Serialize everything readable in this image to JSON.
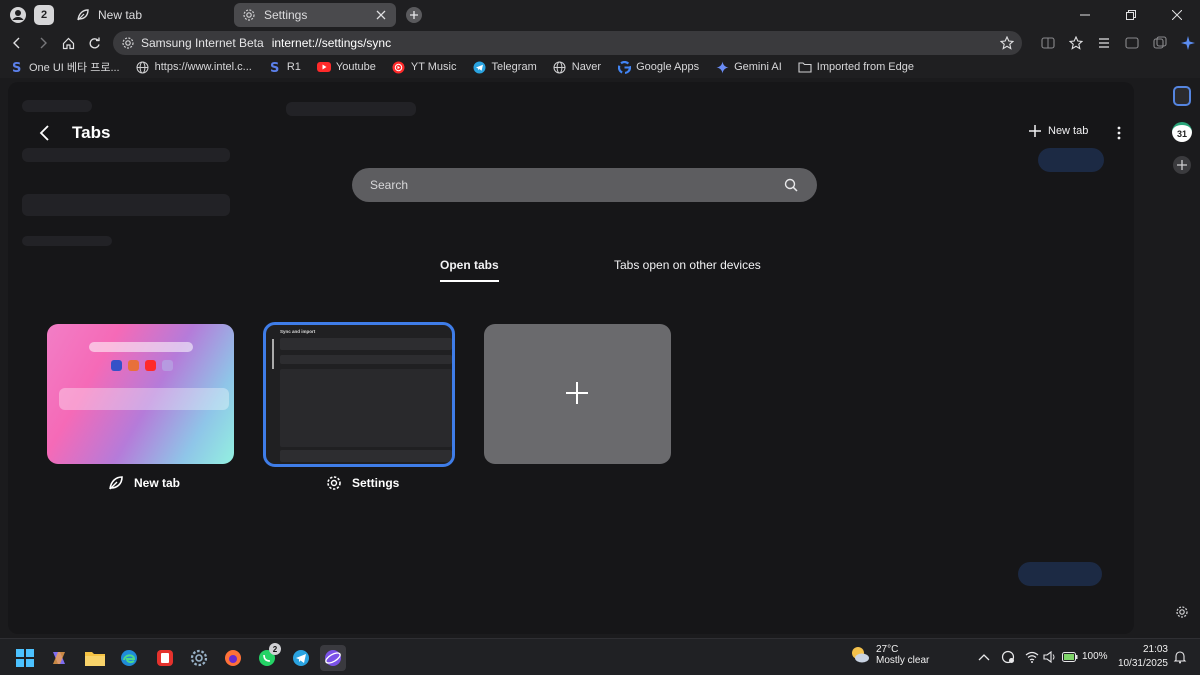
{
  "titlebar": {
    "tab_count": "2",
    "tabs": [
      {
        "title": "New tab",
        "icon": "leaf-icon",
        "active": false
      },
      {
        "title": "Settings",
        "icon": "gear-icon",
        "active": true
      }
    ]
  },
  "navbar": {
    "site_name": "Samsung Internet Beta",
    "url": "internet://settings/sync"
  },
  "bookmarks": [
    {
      "label": "One UI 베타 프로...",
      "icon": "samsung-s-icon"
    },
    {
      "label": "https://www.intel.c...",
      "icon": "globe-icon"
    },
    {
      "label": "R1",
      "icon": "samsung-s-icon"
    },
    {
      "label": "Youtube",
      "icon": "youtube-icon"
    },
    {
      "label": "YT Music",
      "icon": "yt-music-icon"
    },
    {
      "label": "Telegram",
      "icon": "telegram-icon"
    },
    {
      "label": "Naver",
      "icon": "globe-icon"
    },
    {
      "label": "Google Apps",
      "icon": "google-icon"
    },
    {
      "label": "Gemini AI",
      "icon": "gemini-icon"
    },
    {
      "label": "Imported from Edge",
      "icon": "folder-icon"
    }
  ],
  "tabs_panel": {
    "title": "Tabs",
    "new_tab_label": "New tab",
    "search_placeholder": "Search",
    "segments": {
      "open": "Open tabs",
      "other": "Tabs open on other devices"
    },
    "cards": [
      {
        "label": "New tab",
        "icon": "leaf-icon"
      },
      {
        "label": "Settings",
        "icon": "gear-icon"
      }
    ],
    "settings_thumb_heading": "Sync and import"
  },
  "sidebar": {
    "calendar_day": "31"
  },
  "taskbar": {
    "whatsapp_badge": "2",
    "weather_temp": "27°C",
    "weather_desc": "Mostly clear",
    "battery": "100%",
    "time": "21:03",
    "date": "10/31/2025"
  },
  "colors": {
    "accent": "#3f7de8",
    "page_bg": "#161618",
    "search_bg": "#5d5d60"
  }
}
